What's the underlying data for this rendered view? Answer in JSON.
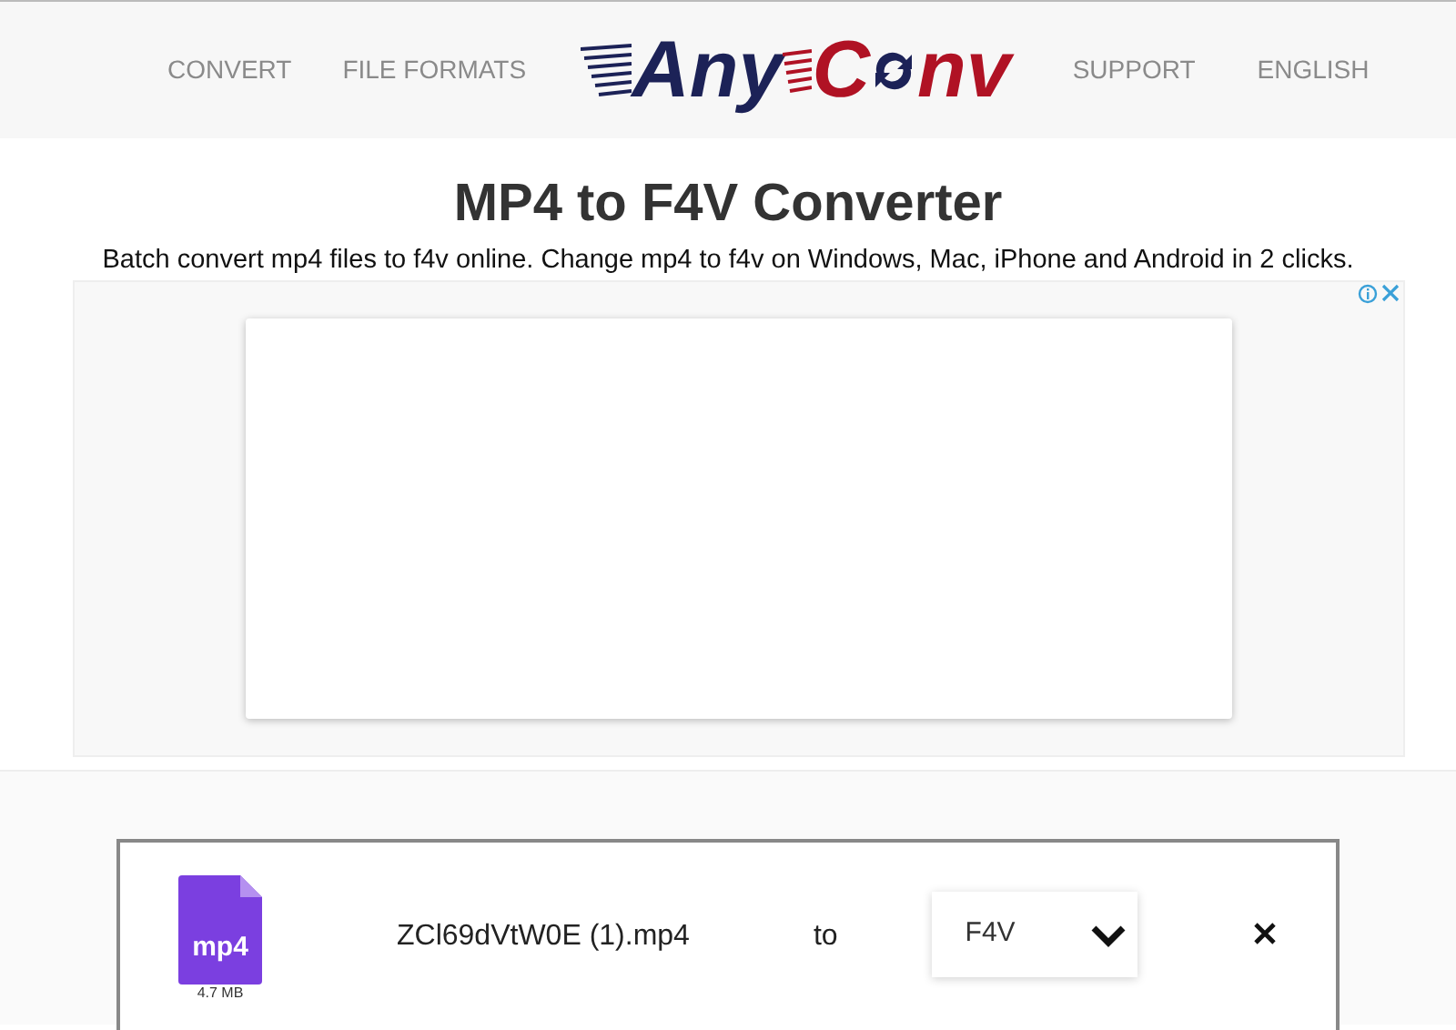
{
  "nav": {
    "left": [
      "CONVERT",
      "FILE FORMATS"
    ],
    "right": [
      "SUPPORT",
      "ENGLISH"
    ]
  },
  "logo": {
    "part_1": "Any",
    "part_2": "C",
    "part_3": "nv"
  },
  "title": "MP4 to F4V Converter",
  "subtitle": "Batch convert mp4 files to f4v online. Change mp4 to f4v on Windows, Mac, iPhone and Android in 2 clicks.",
  "file": {
    "type": "mp4",
    "size": "4.7 MB",
    "name": "ZCl69dVtW0E (1).mp4",
    "connector": "to",
    "target_format": "F4V"
  }
}
